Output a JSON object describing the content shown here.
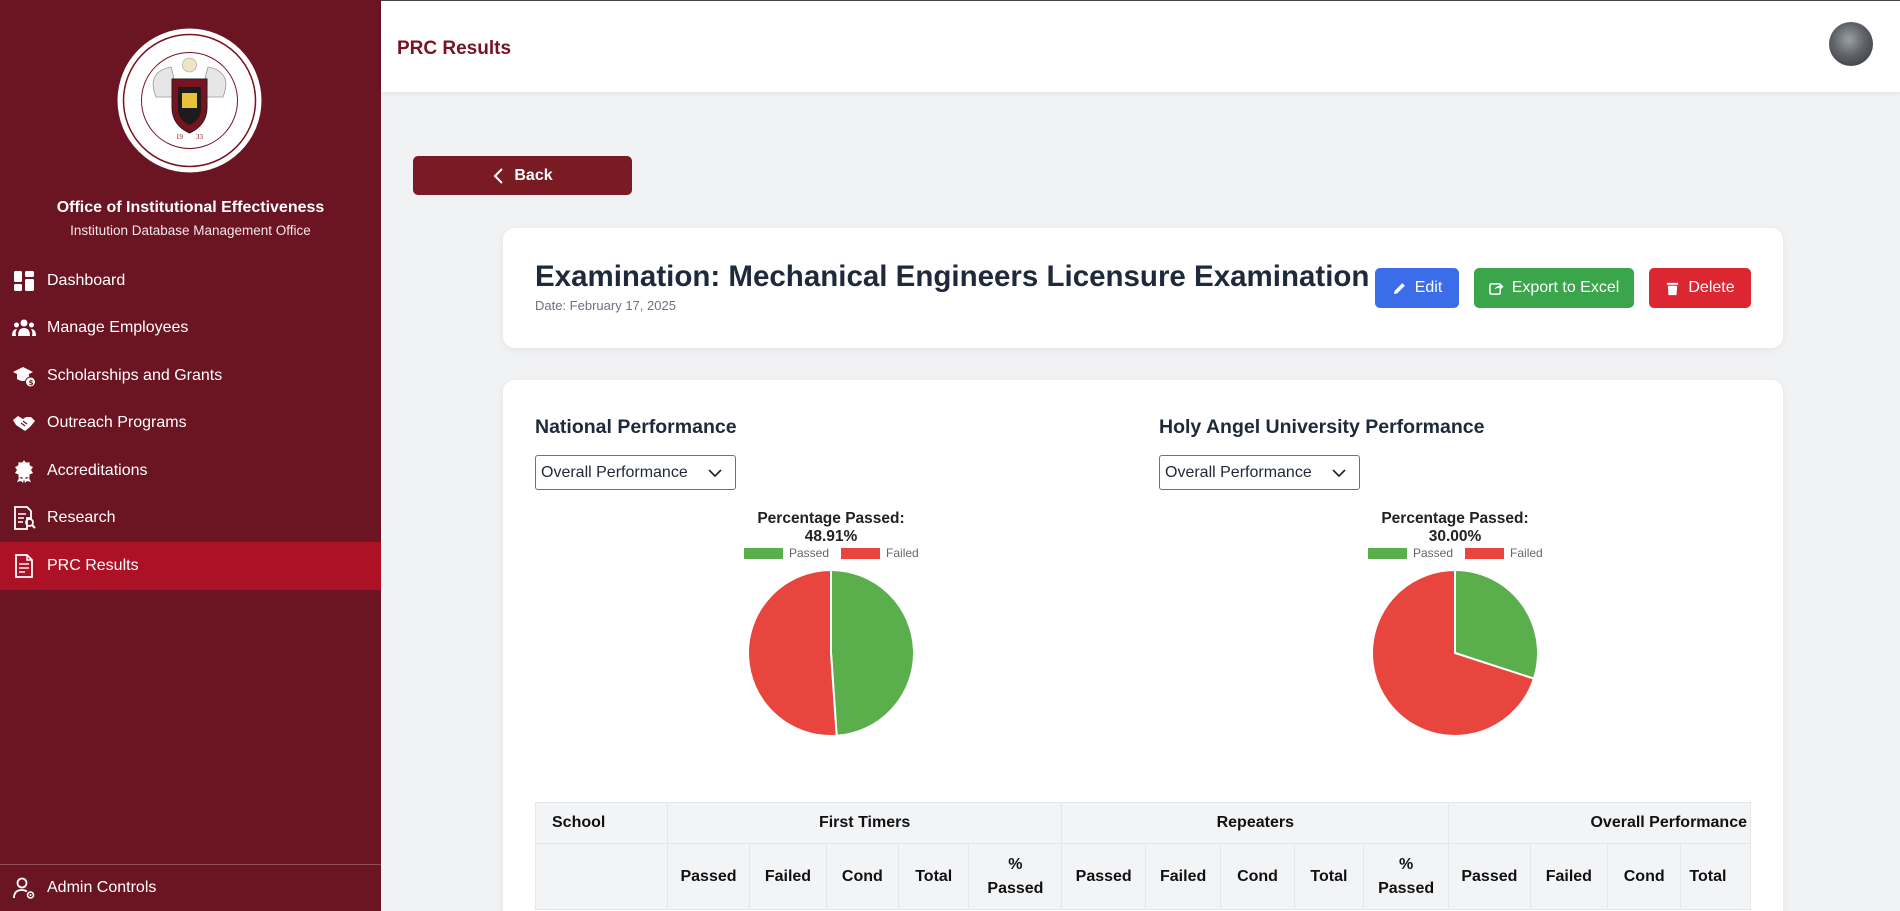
{
  "org": {
    "title": "Office of Institutional Effectiveness",
    "subtitle": "Institution Database Management Office",
    "logo_text": "LAUS DEO SEMPER · HOLY ANGEL UNIVERSITY"
  },
  "nav": [
    {
      "label": "Dashboard",
      "icon": "dashboard-icon",
      "active": false
    },
    {
      "label": "Manage Employees",
      "icon": "employees-icon",
      "active": false
    },
    {
      "label": "Scholarships and Grants",
      "icon": "scholarship-icon",
      "active": false
    },
    {
      "label": "Outreach Programs",
      "icon": "handshake-icon",
      "active": false
    },
    {
      "label": "Accreditations",
      "icon": "award-icon",
      "active": false
    },
    {
      "label": "Research",
      "icon": "research-icon",
      "active": false
    },
    {
      "label": "PRC Results",
      "icon": "document-icon",
      "active": true
    }
  ],
  "admin_label": "Admin Controls",
  "header": {
    "title": "PRC Results"
  },
  "back_label": "Back",
  "exam": {
    "title": "Examination: Mechanical Engineers Licensure Examination",
    "date": "Date: February 17, 2025"
  },
  "actions": {
    "edit": "Edit",
    "export": "Export to Excel",
    "delete": "Delete"
  },
  "panels": {
    "national": {
      "title": "National Performance",
      "select": "Overall Performance"
    },
    "hau": {
      "title": "Holy Angel University Performance",
      "select": "Overall Performance"
    }
  },
  "colors": {
    "passed": "#5aae4c",
    "failed": "#e8453f",
    "primary": "#6b1422"
  },
  "chart_data": [
    {
      "type": "pie",
      "title": "Percentage Passed: 48.91%",
      "categories": [
        "Passed",
        "Failed"
      ],
      "values": [
        48.91,
        51.09
      ],
      "legend": "top"
    },
    {
      "type": "pie",
      "title": "Percentage Passed: 30.00%",
      "categories": [
        "Passed",
        "Failed"
      ],
      "values": [
        30.0,
        70.0
      ],
      "legend": "top"
    }
  ],
  "table": {
    "group_headers": [
      "School",
      "First Timers",
      "Repeaters",
      "Overall Performance"
    ],
    "first_timers_cols": [
      "Passed",
      "Failed",
      "Cond",
      "Total",
      "% Passed"
    ],
    "repeaters_cols": [
      "Passed",
      "Failed",
      "Cond",
      "Total",
      "% Passed"
    ],
    "overall_cols": [
      "Passed",
      "Failed",
      "Cond",
      "Total"
    ]
  }
}
